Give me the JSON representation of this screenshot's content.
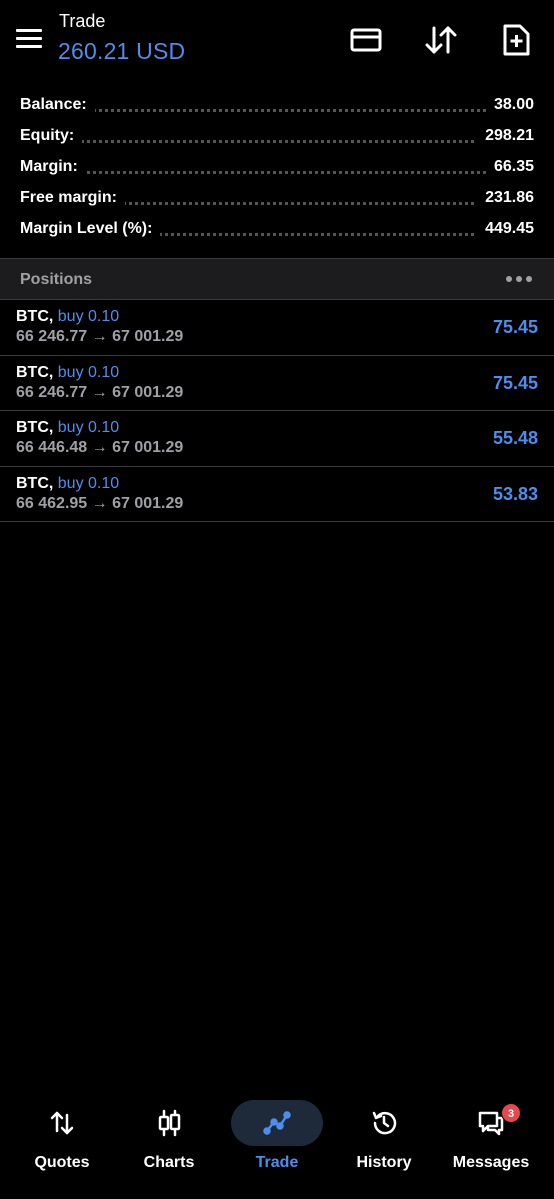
{
  "header": {
    "title": "Trade",
    "value": "260.21 USD",
    "icons": [
      "menu-icon",
      "card-icon",
      "sort-icon",
      "new-order-icon"
    ]
  },
  "summary": [
    {
      "label": "Balance:",
      "value": "38.00"
    },
    {
      "label": "Equity:",
      "value": "298.21"
    },
    {
      "label": "Margin:",
      "value": "66.35"
    },
    {
      "label": "Free margin:",
      "value": "231.86"
    },
    {
      "label": "Margin Level (%):",
      "value": "449.45"
    }
  ],
  "positions": {
    "title": "Positions",
    "items": [
      {
        "symbol": "BTC,",
        "side": "buy 0.10",
        "prices": "66 246.77 → 67 001.29",
        "profit": "75.45"
      },
      {
        "symbol": "BTC,",
        "side": "buy 0.10",
        "prices": "66 246.77 → 67 001.29",
        "profit": "75.45"
      },
      {
        "symbol": "BTC,",
        "side": "buy 0.10",
        "prices": "66 446.48 → 67 001.29",
        "profit": "55.48"
      },
      {
        "symbol": "BTC,",
        "side": "buy 0.10",
        "prices": "66 462.95 → 67 001.29",
        "profit": "53.83"
      }
    ]
  },
  "nav": {
    "items": [
      {
        "label": "Quotes",
        "icon": "quotes-icon"
      },
      {
        "label": "Charts",
        "icon": "charts-icon"
      },
      {
        "label": "Trade",
        "icon": "trade-icon",
        "active": true
      },
      {
        "label": "History",
        "icon": "history-icon"
      },
      {
        "label": "Messages",
        "icon": "messages-icon",
        "badge": "3"
      }
    ]
  },
  "colors": {
    "accent": "#4d8eec",
    "background": "#000000",
    "muted": "#a0a0a5",
    "badge": "#e5484d"
  }
}
